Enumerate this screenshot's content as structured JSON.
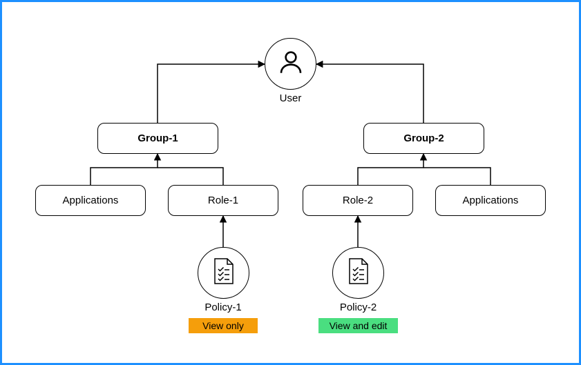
{
  "diagram": {
    "user_label": "User",
    "group1_label": "Group-1",
    "group2_label": "Group-2",
    "applications_left_label": "Applications",
    "role1_label": "Role-1",
    "role2_label": "Role-2",
    "applications_right_label": "Applications",
    "policy1_label": "Policy-1",
    "policy2_label": "Policy-2",
    "policy1_permission": "View only",
    "policy2_permission": "View and edit"
  }
}
